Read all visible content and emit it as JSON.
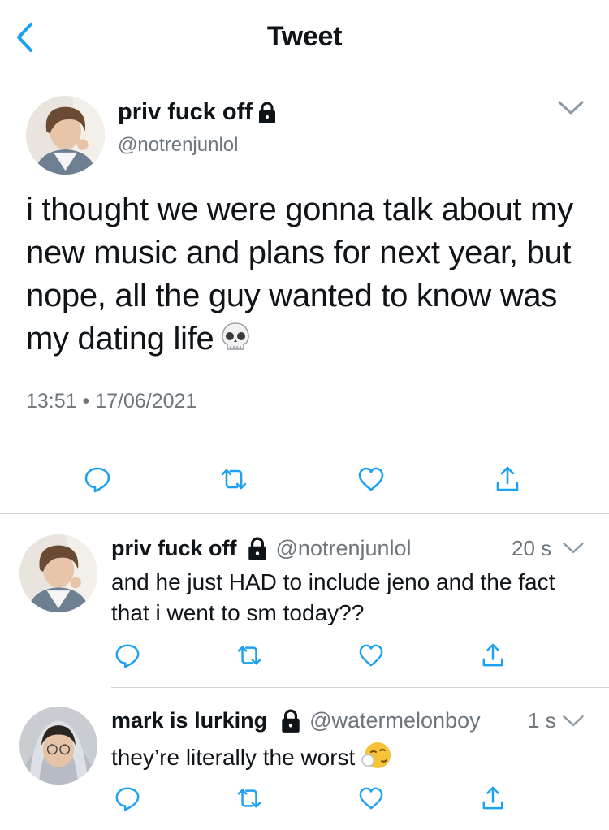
{
  "header": {
    "title": "Tweet",
    "back_icon": "chevron-left-icon"
  },
  "colors": {
    "accent": "#1da1f2",
    "secondary_text": "#6e767d",
    "divider": "#cfd3d6"
  },
  "main_tweet": {
    "display_name": "priv fuck off",
    "handle": "@notrenjunlol",
    "text": "i thought we were gonna talk about my new music and plans for next year, but nope, all the guy wanted to know was my dating life",
    "emoji": "skull-emoji",
    "timestamp": "13:51 • 17/06/2021"
  },
  "replies": [
    {
      "display_name": "priv fuck off",
      "handle": "@notrenjunlol",
      "time": "20 s",
      "text": "and he just HAD to include jeno and the fact that i went to sm today??"
    },
    {
      "display_name": "mark is lurking",
      "handle": "@watermelonboy",
      "time": "1 s",
      "text": "they’re literally the worst",
      "emoji": "sneezing-face-emoji"
    }
  ]
}
